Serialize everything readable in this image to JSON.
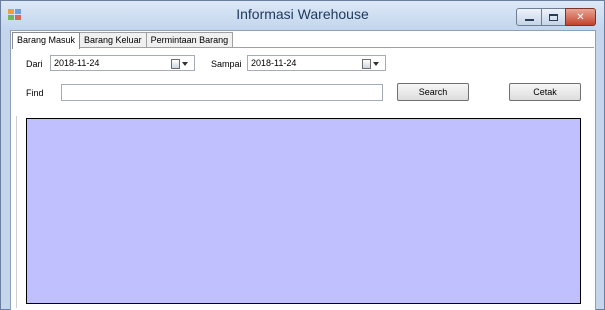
{
  "window": {
    "title": "Informasi Warehouse",
    "buttons": {
      "close_glyph": "✕"
    }
  },
  "tabs": [
    {
      "label": "Barang Masuk",
      "active": true
    },
    {
      "label": "Barang Keluar",
      "active": false
    },
    {
      "label": "Permintaan Barang",
      "active": false
    }
  ],
  "filters": {
    "from_label": "Dari",
    "from_value": "2018-11-24",
    "to_label": "Sampai",
    "to_value": "2018-11-24",
    "find_label": "Find",
    "find_value": ""
  },
  "actions": {
    "search_label": "Search",
    "print_label": "Cetak"
  },
  "colors": {
    "grid_background": "#c0c0ff",
    "titlebar": "#c4d5ec",
    "close_button": "#c2432c"
  }
}
